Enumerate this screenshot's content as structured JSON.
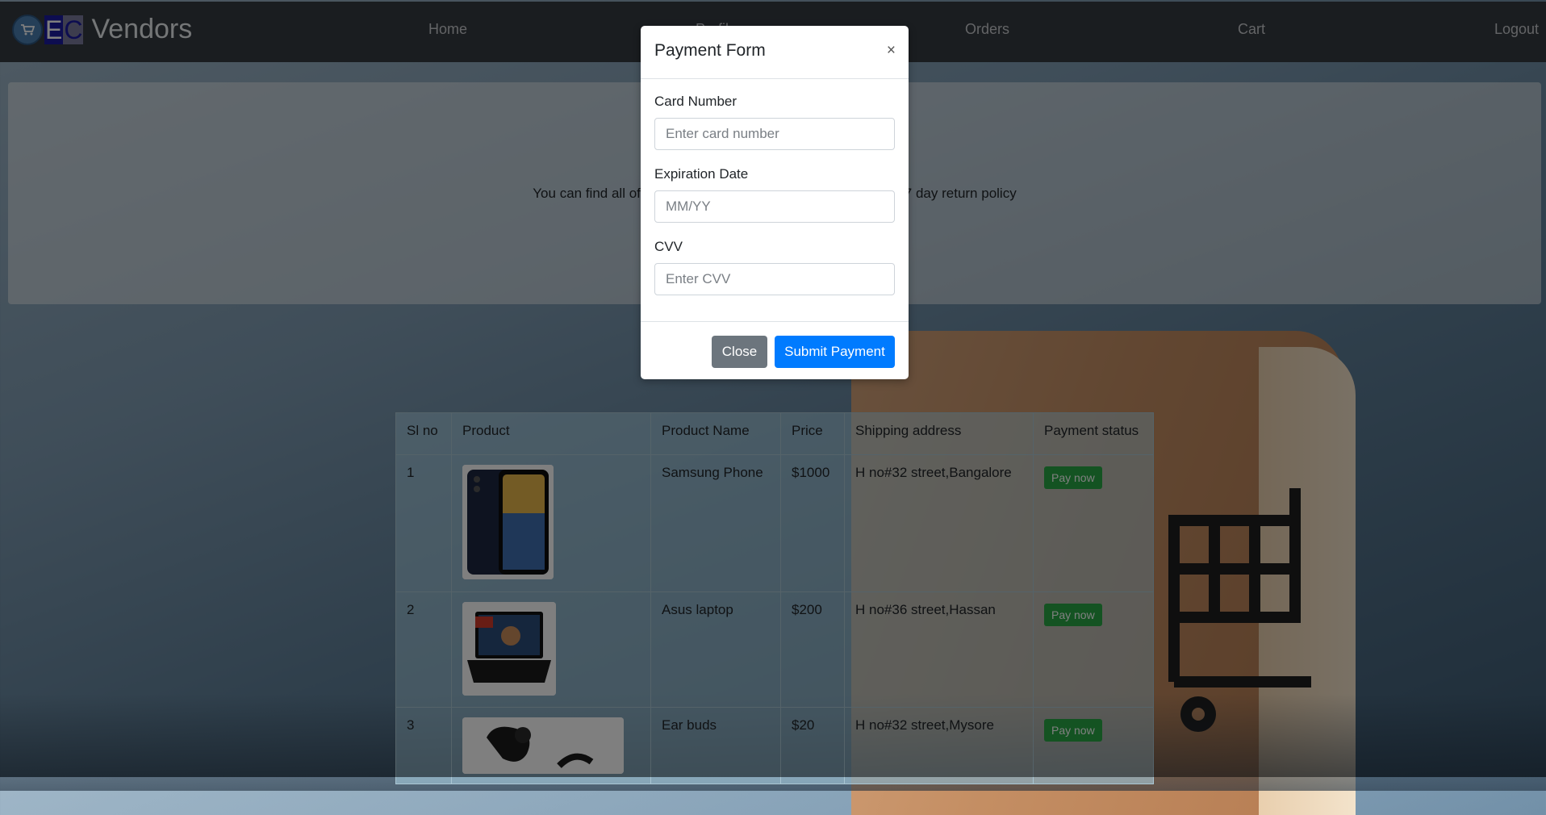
{
  "brand": {
    "e": "E",
    "c": "C",
    "name": "Vendors",
    "logo_icon": "cart-icon"
  },
  "nav": {
    "home": "Home",
    "profile": "Profile",
    "orders": "Orders",
    "cart": "Cart",
    "logout": "Logout"
  },
  "jumbotron": {
    "text": "You can find all of your orders here. All products come with a 7 day return policy"
  },
  "table": {
    "headers": [
      "Sl no",
      "Product",
      "Product Name",
      "Price",
      "Shipping address",
      "Payment status"
    ],
    "rows": [
      {
        "sl": "1",
        "image": "phone-image",
        "name": "Samsung Phone",
        "price": "$1000",
        "address": "H no#32 street,Bangalore",
        "status": "Pay now"
      },
      {
        "sl": "2",
        "image": "laptop-image",
        "name": "Asus laptop",
        "price": "$200",
        "address": "H no#36 street,Hassan",
        "status": "Pay now"
      },
      {
        "sl": "3",
        "image": "earbuds-image",
        "name": "Ear buds",
        "price": "$20",
        "address": "H no#32 street,Mysore",
        "status": "Pay now"
      }
    ]
  },
  "modal": {
    "title": "Payment Form",
    "close_symbol": "×",
    "card_label": "Card Number",
    "card_placeholder": "Enter card number",
    "exp_label": "Expiration Date",
    "exp_placeholder": "MM/YY",
    "cvv_label": "CVV",
    "cvv_placeholder": "Enter CVV",
    "close_button": "Close",
    "submit_button": "Submit Payment"
  },
  "colors": {
    "navbar": "#343a40",
    "primary": "#007bff",
    "secondary": "#6c757d",
    "success": "#28a745"
  }
}
